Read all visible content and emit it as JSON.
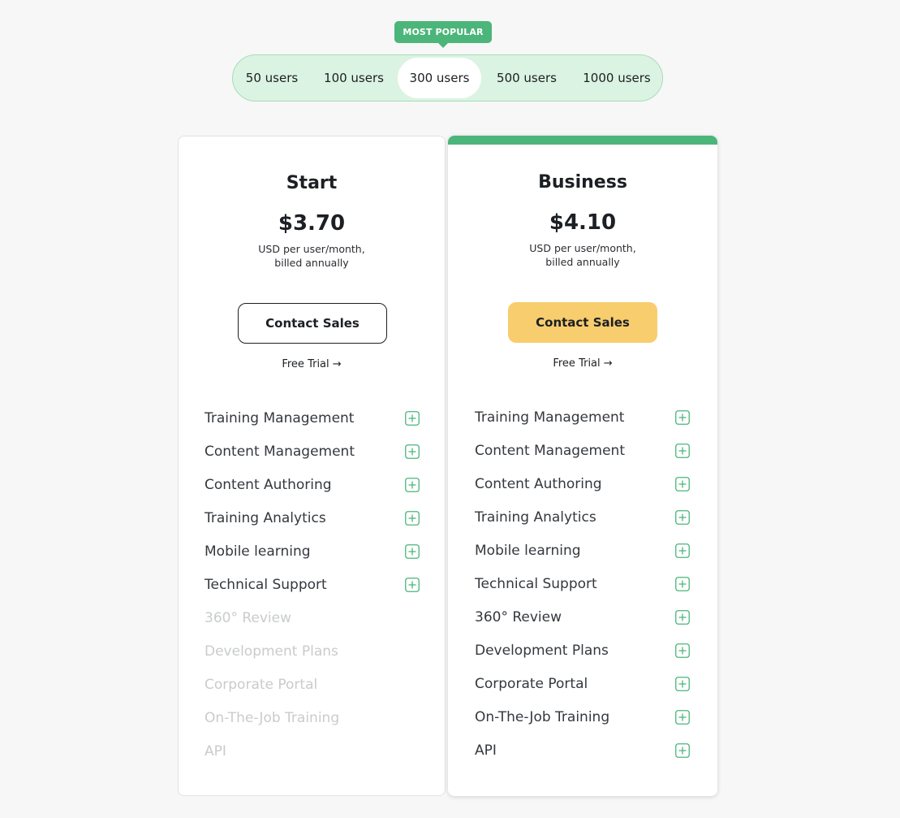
{
  "selector": {
    "badge": "MOST POPULAR",
    "options": [
      "50 users",
      "100 users",
      "300 users",
      "500 users",
      "1000 users"
    ],
    "selected": "300 users"
  },
  "plans": [
    {
      "name": "Start",
      "price": "$3.70",
      "price_note_1": "USD per user/month,",
      "price_note_2": "billed annually",
      "cta": "Contact Sales",
      "trial": "Free Trial →",
      "features": [
        {
          "label": "Training Management",
          "included": true
        },
        {
          "label": "Content Management",
          "included": true
        },
        {
          "label": "Content Authoring",
          "included": true
        },
        {
          "label": "Training Analytics",
          "included": true
        },
        {
          "label": "Mobile learning",
          "included": true
        },
        {
          "label": "Technical Support",
          "included": true
        },
        {
          "label": "360° Review",
          "included": false
        },
        {
          "label": "Development Plans",
          "included": false
        },
        {
          "label": "Corporate Portal",
          "included": false
        },
        {
          "label": "On-The-Job Training",
          "included": false
        },
        {
          "label": "API",
          "included": false
        }
      ]
    },
    {
      "name": "Business",
      "price": "$4.10",
      "price_note_1": "USD per user/month,",
      "price_note_2": "billed annually",
      "cta": "Contact Sales",
      "trial": "Free Trial →",
      "highlighted": true,
      "features": [
        {
          "label": "Training Management",
          "included": true
        },
        {
          "label": "Content Management",
          "included": true
        },
        {
          "label": "Content Authoring",
          "included": true
        },
        {
          "label": "Training Analytics",
          "included": true
        },
        {
          "label": "Mobile learning",
          "included": true
        },
        {
          "label": "Technical Support",
          "included": true
        },
        {
          "label": "360° Review",
          "included": true
        },
        {
          "label": "Development Plans",
          "included": true
        },
        {
          "label": "Corporate Portal",
          "included": true
        },
        {
          "label": "On-The-Job Training",
          "included": true
        },
        {
          "label": "API",
          "included": true
        }
      ]
    }
  ],
  "colors": {
    "accent_green": "#4bb57a",
    "selector_bg": "#dbf3e2",
    "cta_yellow": "#f8cd6e",
    "disabled_text": "#c9cbcd"
  },
  "icons": {
    "feature_expand": "plus-square-icon"
  }
}
